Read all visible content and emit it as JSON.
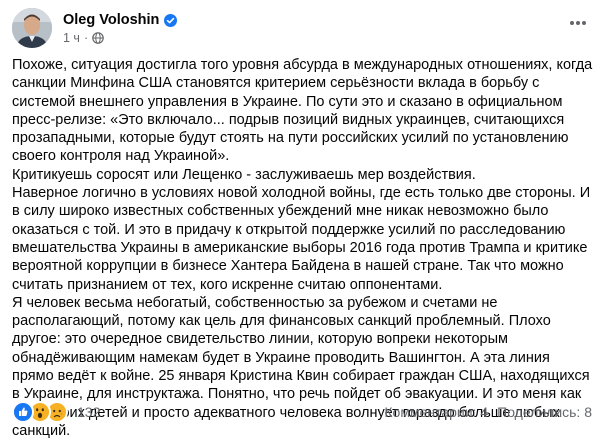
{
  "post": {
    "author": {
      "name": "Oleg Voloshin",
      "avatar_icon": "user-avatar-photo",
      "verified_icon": "verified-badge-icon",
      "verified_color": "#1877f2"
    },
    "meta": {
      "time": "1 ч",
      "separator": "·",
      "audience_icon": "globe-icon"
    },
    "more_icon": "ellipsis-icon",
    "paragraphs": [
      "Похоже, ситуация достигла того уровня абсурда в международных отношениях, когда санкции Минфина США становятся критерием серьёзности вклада в борьбу с системой внешнего управления в Украине. По сути это и сказано в официальном пресс-релизе: «Это включало... подрыв позиций видных украинцев, считающихся прозападными, которые будут стоять на пути российских усилий по установлению своего контроля над Украиной».",
      "Критикуешь соросят или Лещенко - заслуживаешь мер воздействия.",
      "Наверное логично в условиях новой холодной войны, где есть только две стороны. И в силу широко известных собственных убеждений мне никак невозможно было оказаться с той. И это в придачу к открытой поддержке усилий по расследованию вмешательства Украины в американские выборы 2016 года против Трампа и критике вероятной коррупции в бизнесе Хантера Байдена в нашей стране. Так что можно считать признанием от тех, кого искренне считаю оппонентами.",
      "Я человек весьма небогатый, собственностью за рубежом и счетами не располагающий, потому как цель для финансовых санкций проблемный. Плохо другое: это очередное свидетельство линии, которую вопреки некоторым обнадёживающим намекам будет в Украине проводить Вашингтон. А эта линия прямо ведёт к войне. 25 января Кристина Квин собирает граждан США, находящихся в Украине, для инструктажа. Понятно, что речь пойдет об эвакуации. И это меня как отца троих детей и просто адекватного человека волнует гораздо больше любых санкций."
    ]
  },
  "footer": {
    "reactions": [
      {
        "name": "like-reaction-icon",
        "color": "#1877f2"
      },
      {
        "name": "wow-reaction-icon",
        "color": "#f7b125"
      },
      {
        "name": "sad-reaction-icon",
        "color": "#f7b125"
      }
    ],
    "reaction_count": "132",
    "comments": "Комментарии: 4",
    "shares": "Поделились: 8"
  }
}
